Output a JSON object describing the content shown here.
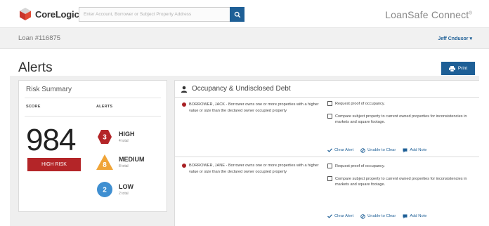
{
  "header": {
    "logo_text": "CoreLogic",
    "logo_mark": "®",
    "search_placeholder": "Enter Account, Borrower or Subject Property Address",
    "brand_product": "LoanSafe Connect",
    "brand_mark": "®"
  },
  "subheader": {
    "loan_number": "Loan #116875",
    "user_name": "Jeff Cndusor ▾"
  },
  "page": {
    "title": "Alerts",
    "print_label": "Print"
  },
  "risk_summary": {
    "title": "Risk Summary",
    "score_header": "SCORE",
    "alerts_header": "ALERTS",
    "score": "984",
    "risk_label": "HIGH RISK",
    "alerts": [
      {
        "count": "3",
        "level": "HIGH",
        "total": "4 total",
        "color": "#b42528",
        "shape": "hexagon-icon"
      },
      {
        "count": "8",
        "level": "MEDIUM",
        "total": "8 total",
        "color": "#f0a437",
        "shape": "triangle-icon"
      },
      {
        "count": "2",
        "level": "LOW",
        "total": "2 total",
        "color": "#3f8fd1",
        "shape": "circle-icon"
      }
    ]
  },
  "occupancy": {
    "title": "Occupancy & Undisclosed Debt",
    "rows": [
      {
        "borrower_text": "BORROWER, JACK - Borrower owns one or more properties with a higher value or size than the declared owner occupied property",
        "tasks": [
          "Request proof of occupancy.",
          "Compare subject property to current owned properties for inconsistencies in markets and square footage."
        ],
        "actions": [
          "Clear Alert",
          "Unable to Clear",
          "Add Note"
        ]
      },
      {
        "borrower_text": "BORROWER, JANE - Borrower owns one or more properties with a higher value or size than the declared owner occupied property",
        "tasks": [
          "Request proof of occupancy.",
          "Compare subject property to current owned properties for inconsistencies in markets and square footage."
        ],
        "actions": [
          "Clear Alert",
          "Unable to Clear",
          "Add Note"
        ]
      }
    ]
  },
  "colors": {
    "primary_blue": "#1e5f96",
    "alert_red": "#b42528",
    "logo_red": "#c8352b"
  }
}
